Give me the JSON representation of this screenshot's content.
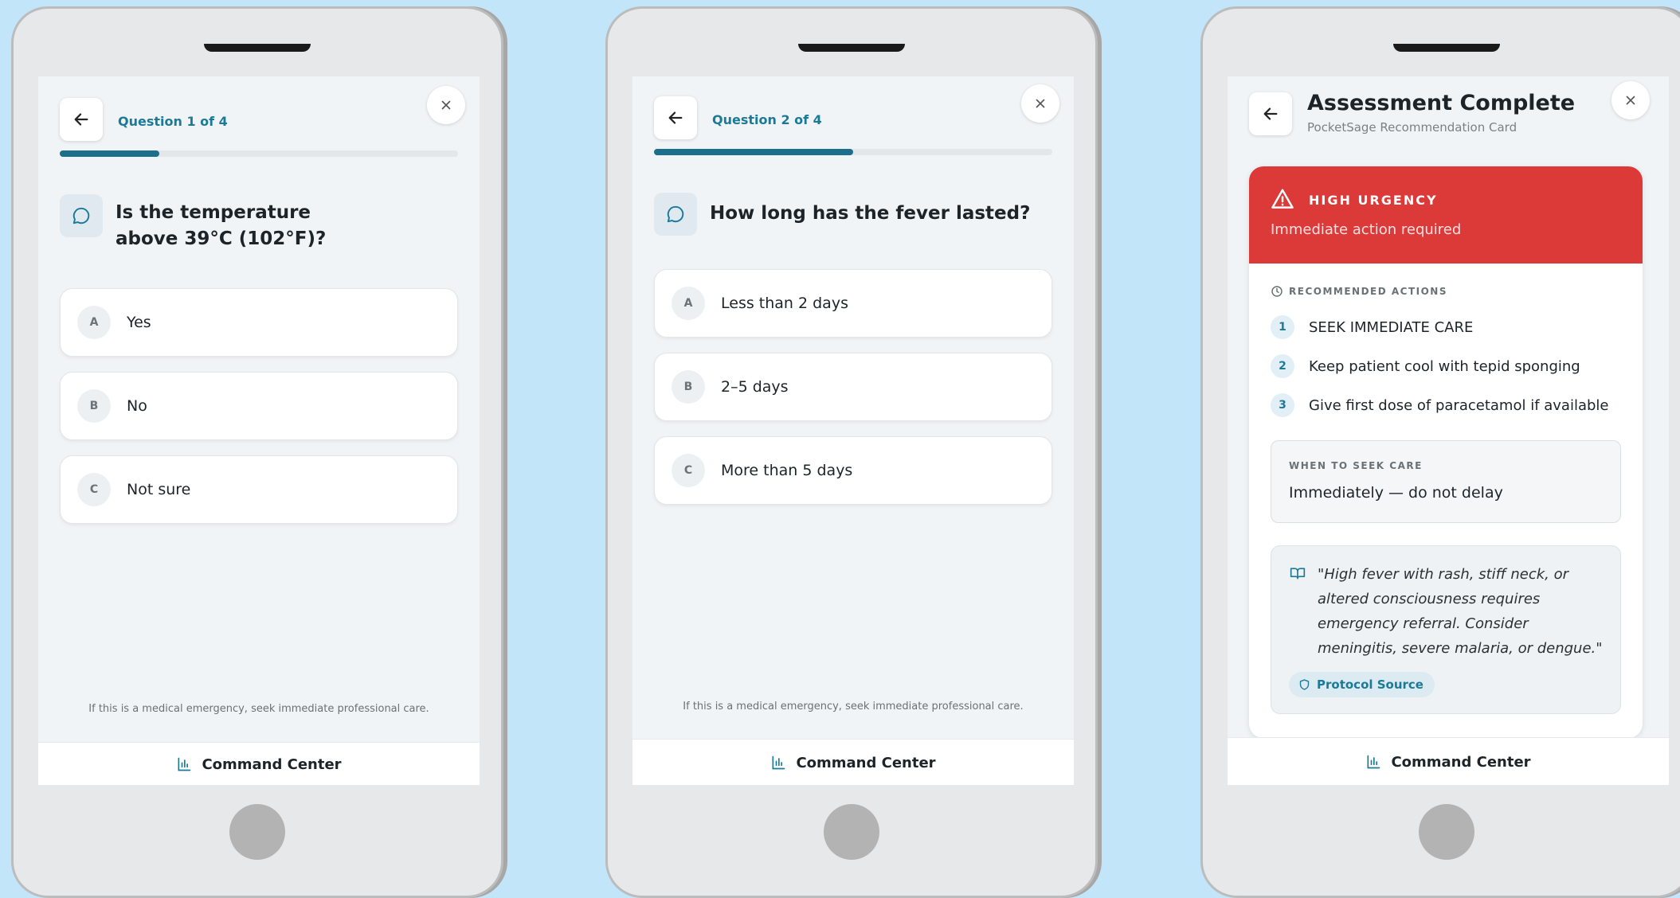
{
  "phones": [
    {
      "question_counter": "Question 1 of 4",
      "progress_fraction": 0.25,
      "question": "Is the temperature above 39°C (102°F)?",
      "question_lines": [
        "Is the temperature",
        "above 39°C (102°F)?"
      ],
      "options": [
        {
          "letter": "A",
          "text": "Yes"
        },
        {
          "letter": "B",
          "text": "No"
        },
        {
          "letter": "C",
          "text": "Not sure"
        }
      ],
      "disclaimer": "If this is a medical emergency, seek immediate professional care.",
      "nav_label": "Command Center"
    },
    {
      "question_counter": "Question 2 of 4",
      "progress_fraction": 0.5,
      "question": "How long has the fever lasted?",
      "options": [
        {
          "letter": "A",
          "text": "Less than 2 days"
        },
        {
          "letter": "B",
          "text": "2–5 days"
        },
        {
          "letter": "C",
          "text": "More than 5 days"
        }
      ],
      "disclaimer": "If this is a medical emergency, seek immediate professional care.",
      "nav_label": "Command Center"
    },
    {
      "title": "Assessment Complete",
      "subtitle": "PocketSage Recommendation Card",
      "urgency": {
        "label": "HIGH URGENCY",
        "subtitle": "Immediate action required",
        "color": "#dc3a39"
      },
      "actions_heading": "RECOMMENDED ACTIONS",
      "actions": [
        {
          "num": "1",
          "text": "SEEK IMMEDIATE CARE"
        },
        {
          "num": "2",
          "text": "Keep patient cool with tepid sponging"
        },
        {
          "num": "3",
          "text": "Give first dose of paracetamol if available"
        }
      ],
      "seek_care": {
        "label": "WHEN TO SEEK CARE",
        "value": "Immediately — do not delay"
      },
      "quote": "\"High fever with rash, stiff neck, or altered consciousness requires emergency referral. Consider meningitis, severe malaria, or dengue.\"",
      "source_label": "Protocol Source",
      "nav_label": "Command Center"
    }
  ],
  "icons": {
    "back": "arrow-left-icon",
    "close": "close-icon",
    "question": "chat-bubble-icon",
    "nav": "bar-chart-icon",
    "warning": "warning-triangle-icon",
    "clock": "clock-icon",
    "book": "open-book-icon",
    "shield": "shield-icon"
  },
  "colors": {
    "accent": "#1b7a97",
    "progress": "#1c6e8d",
    "urgent": "#dc3a39",
    "background": "#c3e5fa"
  }
}
